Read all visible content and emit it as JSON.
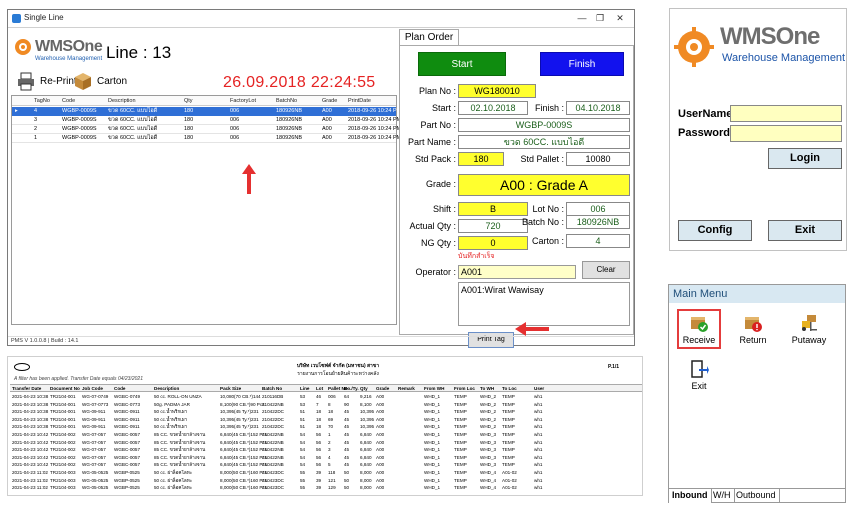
{
  "window": {
    "title": "Single Line",
    "status_bar": "PMS V 1.0.0.8  |  Build : 14.1"
  },
  "header": {
    "brand": "WMSOne",
    "brand_sub": "Warehouse Management",
    "line_label": "Line :  13",
    "datetime": "26.09.2018 22:24:55",
    "reprint_label": "Re-Print",
    "carton_label": "Carton"
  },
  "grid": {
    "columns": [
      "TagNo",
      "Code",
      "Description",
      "Qty",
      "FactoryLot",
      "BatchNo",
      "Grade",
      "PrintDate"
    ],
    "rows": [
      {
        "marker": "▸",
        "tag": "4",
        "code": "WGBP-0009S",
        "desc": "ขวด 60CC. แบบไอดี",
        "qty": "180",
        "lot": "006",
        "batch": "180926NB",
        "grade": "A00",
        "date": "2018-09-26 10:24 PM"
      },
      {
        "marker": "",
        "tag": "3",
        "code": "WGBP-0009S",
        "desc": "ขวด 60CC. แบบไอดี",
        "qty": "180",
        "lot": "006",
        "batch": "180926NB",
        "grade": "A00",
        "date": "2018-09-26 10:24 PM"
      },
      {
        "marker": "",
        "tag": "2",
        "code": "WGBP-0009S",
        "desc": "ขวด 60CC. แบบไอดี",
        "qty": "180",
        "lot": "006",
        "batch": "180926NB",
        "grade": "A00",
        "date": "2018-09-26 10:24 PM"
      },
      {
        "marker": "",
        "tag": "1",
        "code": "WGBP-0009S",
        "desc": "ขวด 60CC. แบบไอดี",
        "qty": "180",
        "lot": "006",
        "batch": "180926NB",
        "grade": "A00",
        "date": "2018-09-26 10:24 PM"
      }
    ]
  },
  "plan": {
    "tab": "Plan Order",
    "start_button": "Start",
    "finish_button": "Finish",
    "plan_no_label": "Plan No :",
    "plan_no": "WG180010",
    "start_label": "Start :",
    "start_date": "02.10.2018",
    "finish_label": "Finish :",
    "finish_date": "04.10.2018",
    "part_no_label": "Part No :",
    "part_no": "WGBP-0009S",
    "part_name_label": "Part Name :",
    "part_name": "ขวด 60CC. แบบไอดี",
    "std_pack_label": "Std Pack :",
    "std_pack": "180",
    "std_pallet_label": "Std Pallet :",
    "std_pallet": "10080",
    "grade_label": "Grade :",
    "grade": "A00 : Grade A",
    "shift_label": "Shift :",
    "shift": "B",
    "lot_no_label": "Lot No :",
    "lot_no": "006",
    "actual_qty_label": "Actual Qty :",
    "actual_qty": "720",
    "batch_no_label": "Batch No :",
    "batch_no": "180926NB",
    "ng_qty_label": "NG Qty :",
    "ng_qty": "0",
    "carton_label": "Carton :",
    "carton": "4",
    "saved_text": "บันทึกสำเร็จ",
    "operator_label": "Operator :",
    "operator": "A001",
    "clear_button": "Clear",
    "operator_memo": "A001:Wirat Wawisay",
    "print_button": "Print Tag"
  },
  "report": {
    "company_line1": "บริษัท เวบโซฟต์ จำกัด (มหาชน) สาขา",
    "company_line2": "รายงานการโอนย้ายสินค้าระหว่างคลัง",
    "page": "P.1/1",
    "filter_note": "A filter has been applied. Transfer Date equals 04/23/2021",
    "columns": [
      "Transfer Date",
      "Document No",
      "Job Code",
      "Code",
      "Description",
      "Pack Size",
      "Batch No",
      "Line",
      "Lot",
      "Pallet No",
      "Bo./Ty.",
      "Qty",
      "Grade",
      "Remark",
      "From WH",
      "From Loc",
      "To WH",
      "To Loc",
      "User"
    ],
    "rows": [
      [
        "2021-04-23 10:38",
        "TR2104-001",
        "WG-07-0749",
        "WGBC-0749",
        "50 cc. ROLL-ON UNZA",
        "10,080(70 CB.*)144",
        "210116DB",
        "53",
        "46",
        "006",
        "64",
        "9,216",
        "A00",
        "",
        "WHD_1",
        "TEMP",
        "WHD_2",
        "TEMP",
        "wh1"
      ],
      [
        "2021-04-23 10:38",
        "TR2104-001",
        "WG-07-0773",
        "WGBC-0773",
        "50g. PADMA JAR",
        "8,100(90 CB.*)90 Pcs.",
        "210422NB",
        "53",
        "7",
        "8",
        "90",
        "8,100",
        "A00",
        "",
        "WHD_1",
        "TEMP",
        "WHD_2",
        "TEMP",
        "wh1"
      ],
      [
        "2021-04-23 10:38",
        "TR2104-001",
        "WG-09-911",
        "WGBC-0911",
        "50 cc.น้ำพริกเผา",
        "10,395(45 Ty.*)231",
        "210422DC",
        "51",
        "18",
        "18",
        "45",
        "10,395",
        "A00",
        "",
        "WHD_1",
        "TEMP",
        "WHD_2",
        "TEMP",
        "wh1"
      ],
      [
        "2021-04-23 10:38",
        "TR2104-001",
        "WG-09-911",
        "WGBC-0911",
        "50 cc.น้ำพริกเผา",
        "10,395(45 Ty.*)231",
        "210422DC",
        "51",
        "18",
        "69",
        "45",
        "10,395",
        "A00",
        "",
        "WHD_1",
        "TEMP",
        "WHD_2",
        "TEMP",
        "wh1"
      ],
      [
        "2021-04-23 10:38",
        "TR2104-001",
        "WG-09-911",
        "WGBC-0911",
        "50 cc.น้ำพริกเผา",
        "10,395(45 Ty.*)231",
        "210422DC",
        "51",
        "18",
        "70",
        "45",
        "10,395",
        "A00",
        "",
        "WHD_1",
        "TEMP",
        "WHD_2",
        "TEMP",
        "wh1"
      ],
      [
        "2021-04-23 10:42",
        "TR2104-002",
        "WG-07-057",
        "WGBC-0057",
        "85 CC. ขวดน้ำยาล้างจาน",
        "6,840(45 CB.*)152 Pcs.",
        "210422NB",
        "54",
        "56",
        "1",
        "45",
        "6,840",
        "A00",
        "",
        "WHD_1",
        "TEMP",
        "WHD_3",
        "TEMP",
        "wh1"
      ],
      [
        "2021-04-23 10:42",
        "TR2104-002",
        "WG-07-057",
        "WGBC-0057",
        "85 CC. ขวดน้ำยาล้างจาน",
        "6,840(45 CB.*)152 Pcs.",
        "210422NB",
        "54",
        "56",
        "2",
        "45",
        "6,840",
        "A00",
        "",
        "WHD_1",
        "TEMP",
        "WHD_3",
        "TEMP",
        "wh1"
      ],
      [
        "2021-04-23 10:42",
        "TR2104-002",
        "WG-07-057",
        "WGBC-0057",
        "85 CC. ขวดน้ำยาล้างจาน",
        "6,840(45 CB.*)152 Pcs.",
        "210422NB",
        "54",
        "56",
        "3",
        "45",
        "6,840",
        "A00",
        "",
        "WHD_1",
        "TEMP",
        "WHD_3",
        "TEMP",
        "wh1"
      ],
      [
        "2021-04-23 10:42",
        "TR2104-002",
        "WG-07-057",
        "WGBC-0057",
        "85 CC. ขวดน้ำยาล้างจาน",
        "6,840(45 CB.*)152 Pcs.",
        "210422NB",
        "54",
        "56",
        "4",
        "45",
        "6,840",
        "A00",
        "",
        "WHD_1",
        "TEMP",
        "WHD_3",
        "TEMP",
        "wh1"
      ],
      [
        "2021-04-23 10:42",
        "TR2104-002",
        "WG-07-057",
        "WGBC-0057",
        "85 CC. ขวดน้ำยาล้างจาน",
        "6,840(45 CB.*)152 Pcs.",
        "210422NB",
        "54",
        "56",
        "5",
        "45",
        "6,840",
        "A00",
        "",
        "WHD_1",
        "TEMP",
        "WHD_3",
        "TEMP",
        "wh1"
      ],
      [
        "2021-04-23 11:02",
        "TR2104-003",
        "WG-05-0525",
        "WGBP-0525",
        "50 cc. ฝาล็อคโลหะ",
        "8,000(50 CB.*)160 Pcs.",
        "210423DC",
        "55",
        "39",
        "118",
        "50",
        "8,000",
        "A00",
        "",
        "WHD_1",
        "TEMP",
        "WHD_4",
        "A01-02",
        "wh1"
      ],
      [
        "2021-04-23 11:02",
        "TR2104-003",
        "WG-05-0525",
        "WGBP-0525",
        "50 cc. ฝาล็อคโลหะ",
        "8,000(50 CB.*)160 Pcs.",
        "210423DC",
        "55",
        "39",
        "121",
        "50",
        "8,000",
        "A00",
        "",
        "WHD_1",
        "TEMP",
        "WHD_4",
        "A01-02",
        "wh1"
      ],
      [
        "2021-04-23 11:02",
        "TR2104-003",
        "WG-05-0525",
        "WGBP-0525",
        "50 cc. ฝาล็อคโลหะ",
        "8,000(50 CB.*)160 Pcs.",
        "210423DC",
        "55",
        "39",
        "129",
        "50",
        "8,000",
        "A00",
        "",
        "WHD_1",
        "TEMP",
        "WHD_4",
        "A01-02",
        "wh1"
      ]
    ]
  },
  "login": {
    "brand": "WMSOne",
    "brand_sub": "Warehouse Management",
    "username_label": "UserName",
    "password_label": "Password",
    "login_button": "Login",
    "config_button": "Config",
    "exit_button": "Exit"
  },
  "menu": {
    "title": "Main Menu",
    "items": [
      "Receive",
      "Return",
      "Putaway",
      "Exit"
    ],
    "tabs": [
      "Inbound",
      "W/H",
      "Outbound"
    ]
  }
}
